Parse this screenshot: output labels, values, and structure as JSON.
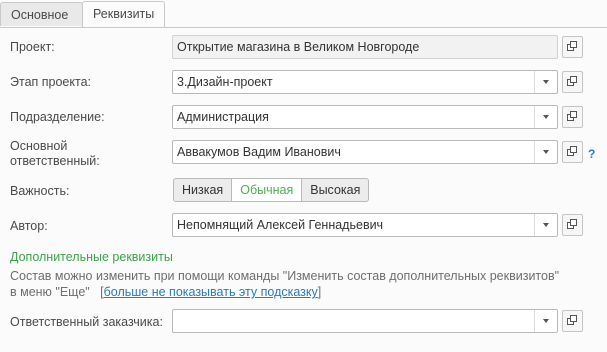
{
  "tabs": [
    {
      "label": "Основное"
    },
    {
      "label": "Реквизиты"
    }
  ],
  "fields": {
    "project": {
      "label": "Проект:",
      "value": "Открытие магазина в Великом Новгороде"
    },
    "stage": {
      "label": "Этап проекта:",
      "value": "3.Дизайн-проект"
    },
    "department": {
      "label": "Подразделение:",
      "value": "Администрация"
    },
    "responsible": {
      "label_line1": "Основной",
      "label_line2": "ответственный:",
      "value": "Аввакумов Вадим Иванович",
      "help": "?"
    },
    "importance": {
      "label": "Важность:",
      "options": [
        "Низкая",
        "Обычная",
        "Высокая"
      ],
      "selected": "Обычная"
    },
    "author": {
      "label": "Автор:",
      "value": "Непомнящий Алексей Геннадьевич"
    },
    "customer_responsible": {
      "label": "Ответственный заказчика:",
      "value": ""
    }
  },
  "additional": {
    "title": "Дополнительные реквизиты",
    "hint_line1": "Состав можно изменить при помощи команды \"Изменить состав дополнительных реквизитов\"",
    "hint_line2": "в меню \"Еще\"",
    "hint_link": "больше не показывать эту подсказку"
  }
}
